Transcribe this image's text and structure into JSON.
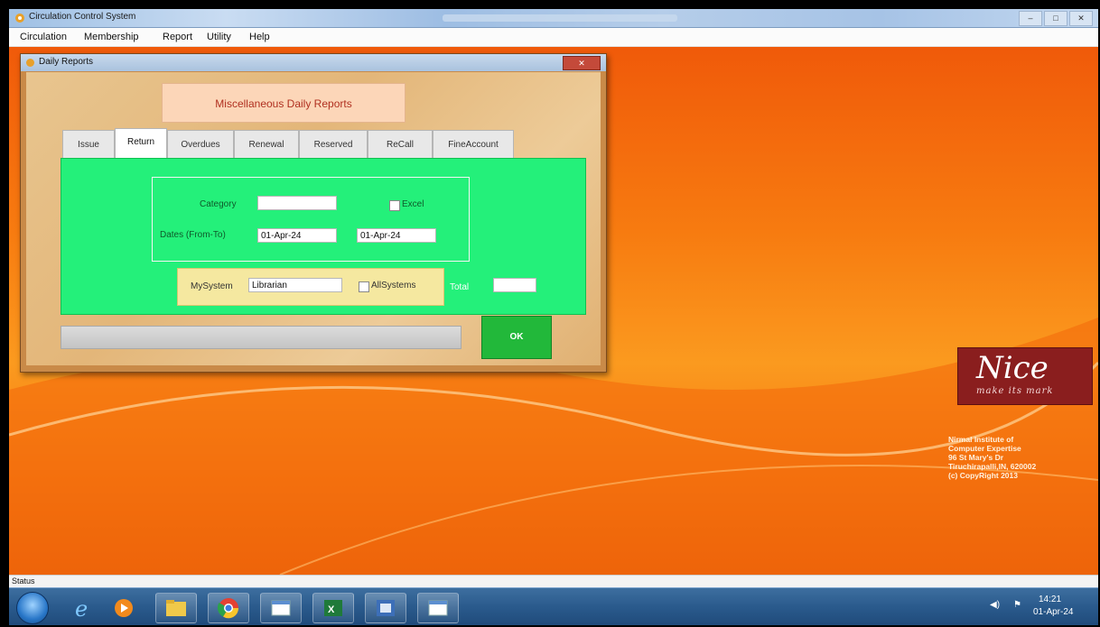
{
  "app": {
    "title": "Circulation Control System",
    "status": "Status"
  },
  "menu": [
    "Circulation",
    "Membership",
    "Report",
    "Utility",
    "Help"
  ],
  "dialog": {
    "title": "Daily Reports",
    "header": "Miscellaneous Daily Reports",
    "tabs": [
      "Issue",
      "Return",
      "Overdues",
      "Renewal",
      "Reserved",
      "ReCall",
      "FineAccount"
    ],
    "active_tab": "Return",
    "category_label": "Category",
    "category_value": "",
    "excel_label": "Excel",
    "dates_label": "Dates (From-To)",
    "date_from": "01-Apr-24",
    "date_to": "01-Apr-24",
    "mysystem_label": "MySystem",
    "mysystem_value": "Librarian",
    "allsystems_label": "AllSystems",
    "total_label": "Total",
    "total_value": "",
    "ok_label": "OK"
  },
  "branding": {
    "logo": "Nice",
    "tagline": "make its mark",
    "institute": [
      "Nirmal Institute of",
      "Computer Expertise",
      "96 St Mary's Dr",
      "Tiruchirapalli,IN, 620002",
      "(c) CopyRight 2013"
    ]
  },
  "tray": {
    "time": "14:21",
    "date": "01-Apr-24"
  },
  "colors": {
    "panel_green": "#24f07a",
    "ok_green": "#22b83a",
    "desktop_orange": "#f77b10",
    "logo_maroon": "#8a1e1e"
  }
}
